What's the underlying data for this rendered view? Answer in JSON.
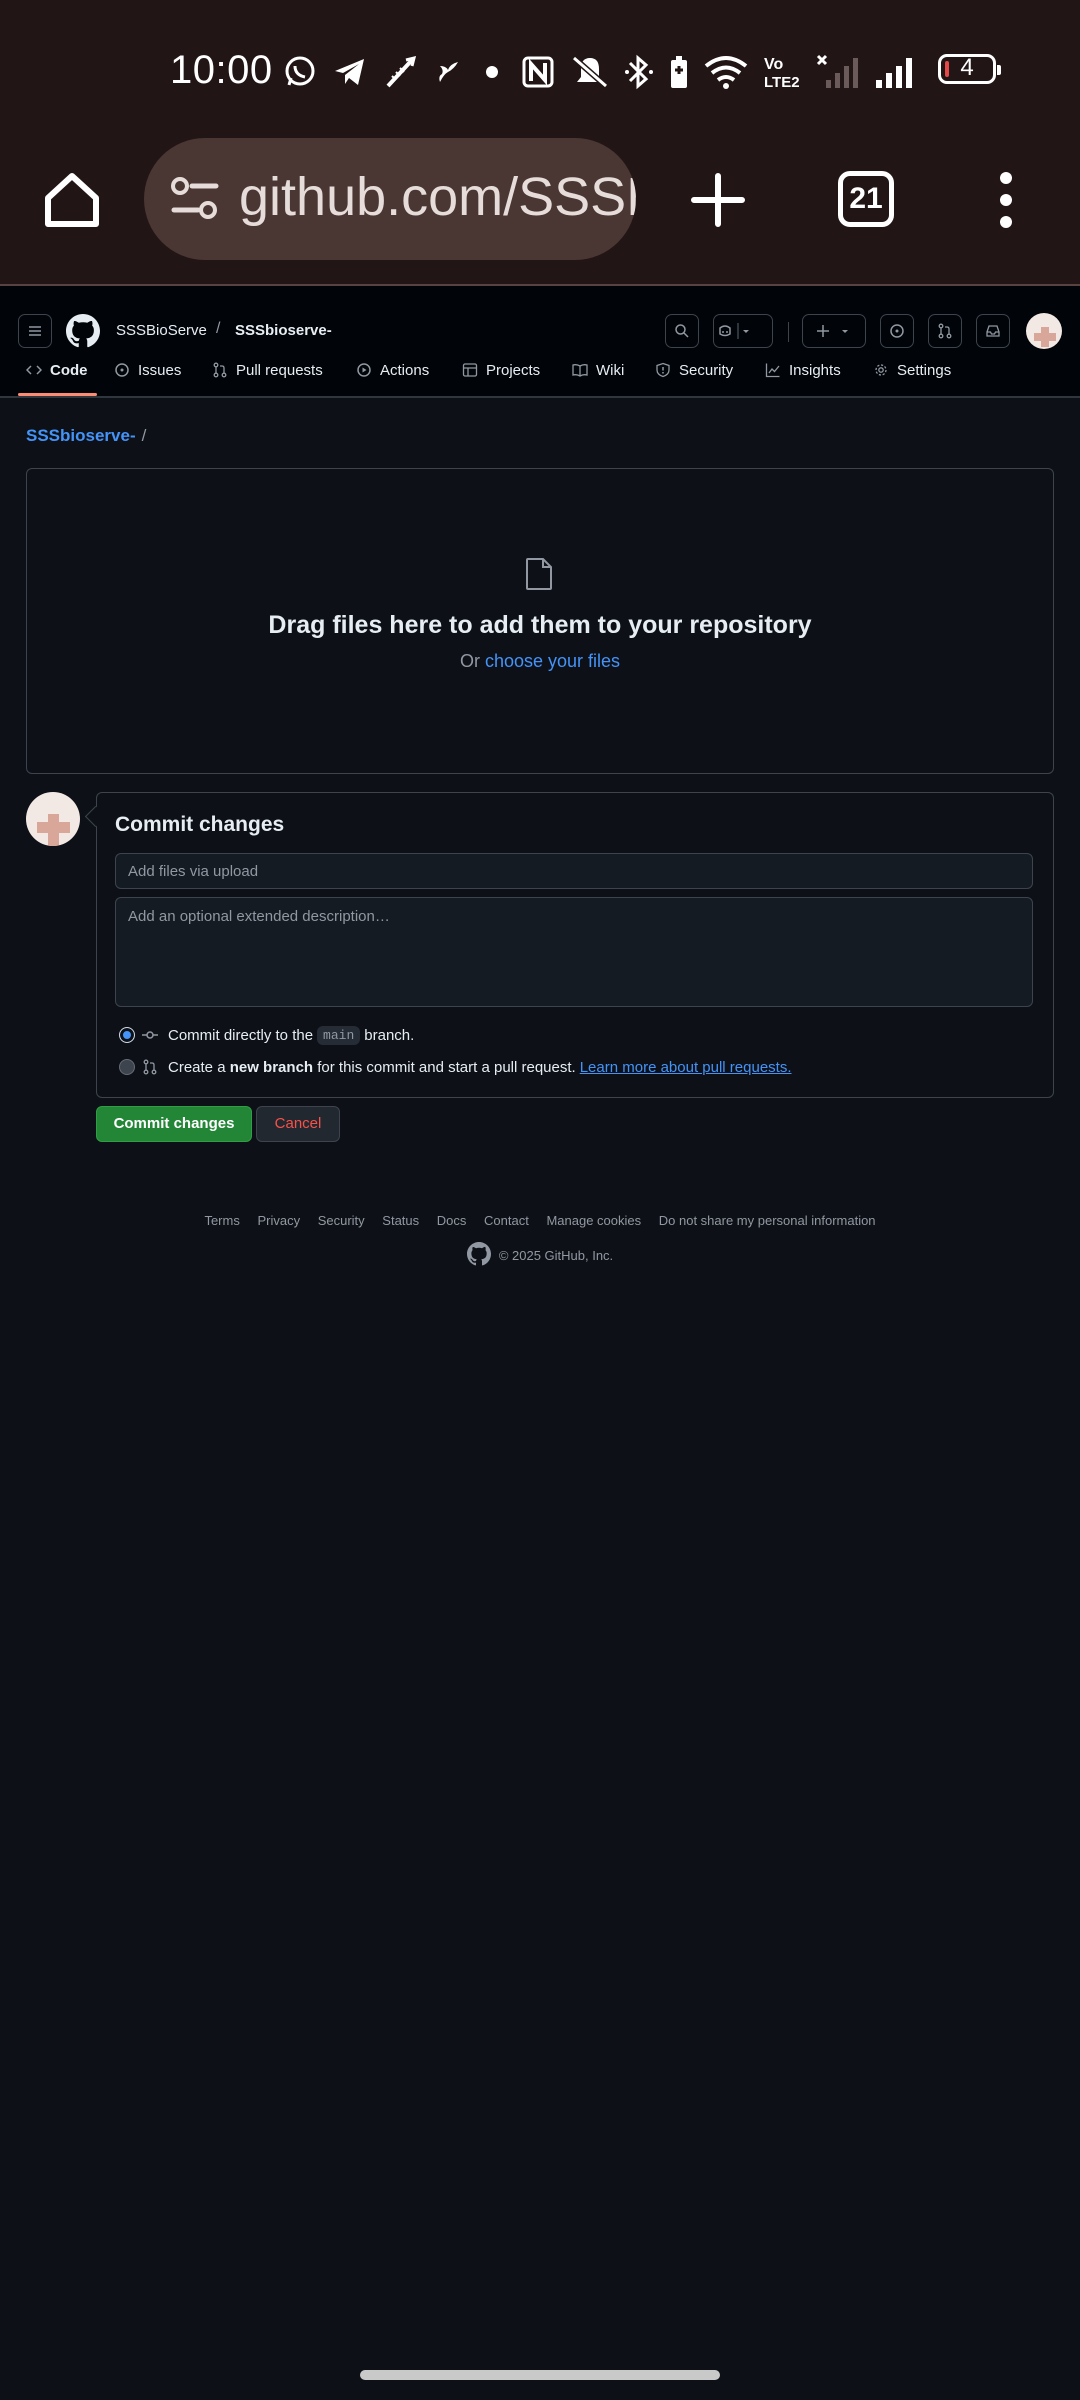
{
  "status_bar": {
    "time": "10:00",
    "battery_level": "4",
    "icons": [
      "whatsapp-icon",
      "telegram-icon",
      "brush-icon",
      "fan-icon",
      "dot-icon",
      "nfc-icon",
      "mute-icon",
      "bluetooth-icon",
      "wifi-icon",
      "volte-icon",
      "signal-off-icon",
      "signal-icon",
      "battery-icon"
    ]
  },
  "browser": {
    "url": "github.com/SSSB",
    "tab_count": "21"
  },
  "header": {
    "owner": "SSSBioServe",
    "separator": "/",
    "repo": "SSSbioserve-"
  },
  "nav": {
    "tabs": [
      {
        "label": "Code",
        "icon": "code-icon",
        "active": true
      },
      {
        "label": "Issues",
        "icon": "issue-icon"
      },
      {
        "label": "Pull requests",
        "icon": "pull-request-icon"
      },
      {
        "label": "Actions",
        "icon": "play-icon"
      },
      {
        "label": "Projects",
        "icon": "table-icon"
      },
      {
        "label": "Wiki",
        "icon": "book-icon"
      },
      {
        "label": "Security",
        "icon": "shield-icon"
      },
      {
        "label": "Insights",
        "icon": "graph-icon"
      },
      {
        "label": "Settings",
        "icon": "gear-icon"
      }
    ]
  },
  "breadcrumb": {
    "repo": "SSSbioserve-",
    "slash": "/"
  },
  "dropzone": {
    "title": "Drag files here to add them to your repository",
    "or_text": "Or",
    "choose_link": "choose your files"
  },
  "commit": {
    "title": "Commit changes",
    "summary_placeholder": "Add files via upload",
    "description_placeholder": "Add an optional extended description…",
    "direct_prefix": "Commit directly to the",
    "branch": "main",
    "direct_suffix": "branch.",
    "new_prefix": "Create a",
    "new_bold": "new branch",
    "new_suffix": "for this commit and start a pull request.",
    "learn_more": "Learn more about pull requests.",
    "submit_label": "Commit changes",
    "cancel_label": "Cancel"
  },
  "footer": {
    "links": [
      "Terms",
      "Privacy",
      "Security",
      "Status",
      "Docs",
      "Contact",
      "Manage cookies",
      "Do not share my personal information"
    ],
    "copyright": "© 2025 GitHub, Inc."
  },
  "colors": {
    "accent_link": "#4493f8",
    "primary_button": "#238636",
    "danger_text": "#f85149",
    "tab_underline": "#fd8c73",
    "browser_bar": "#221515"
  }
}
